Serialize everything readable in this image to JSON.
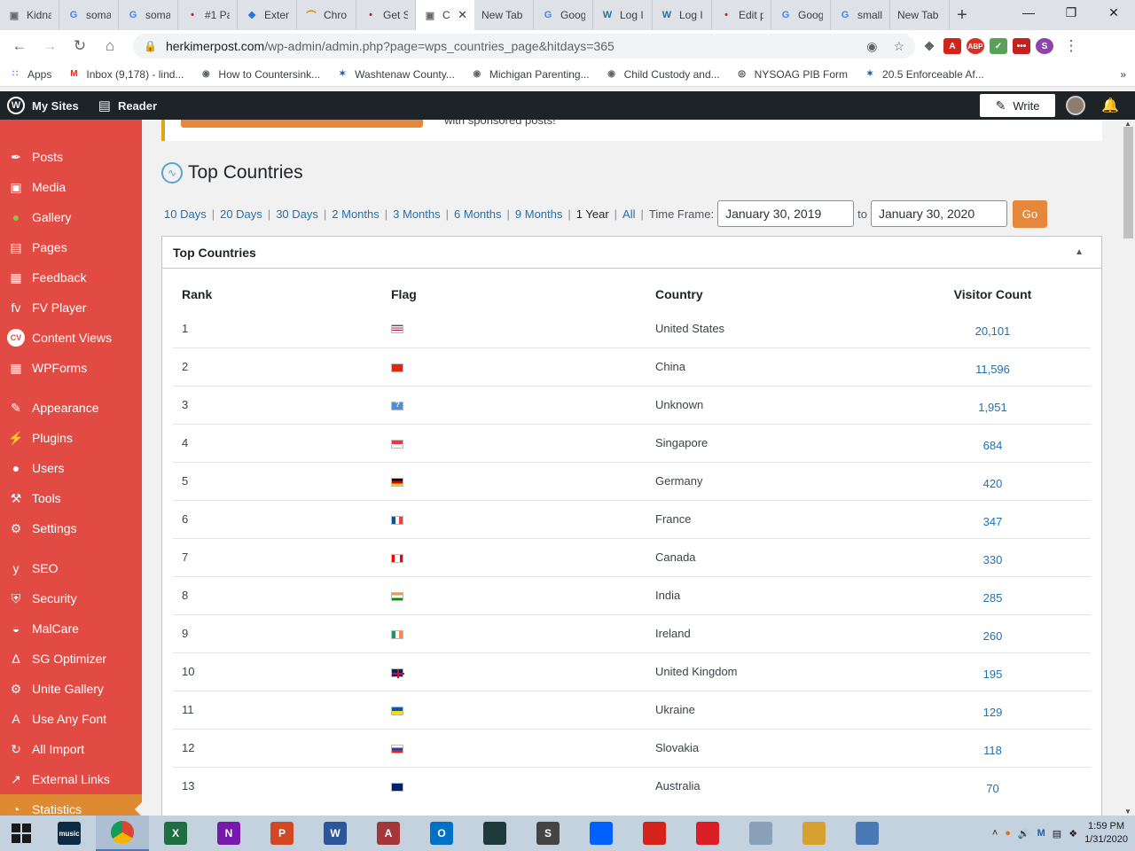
{
  "browser": {
    "tabs": [
      {
        "title": "Kidna",
        "icon": "site-icon",
        "color": "#6b6b6b"
      },
      {
        "title": "soma",
        "icon": "google-icon",
        "color": "#4285f4"
      },
      {
        "title": "soma",
        "icon": "google-icon",
        "color": "#4285f4"
      },
      {
        "title": "#1 Pa",
        "icon": "red-dots-icon",
        "color": "#c5221f"
      },
      {
        "title": "Exten",
        "icon": "puzzle-icon",
        "color": "#1a73e8"
      },
      {
        "title": "Chro",
        "icon": "rainbow-icon",
        "color": "#e37400"
      },
      {
        "title": "Get S",
        "icon": "red-dots-icon",
        "color": "#c5221f"
      },
      {
        "title": "C",
        "icon": "site-icon",
        "color": "#6b6b6b",
        "active": true
      },
      {
        "title": "New Tab",
        "icon": "",
        "color": ""
      },
      {
        "title": "Goog",
        "icon": "google-icon",
        "color": "#4285f4"
      },
      {
        "title": "Log I",
        "icon": "wordpress-icon",
        "color": "#21759b"
      },
      {
        "title": "Log I",
        "icon": "wordpress-icon",
        "color": "#21759b"
      },
      {
        "title": "Edit p",
        "icon": "red-dots-icon",
        "color": "#c5221f"
      },
      {
        "title": "Goog",
        "icon": "google-icon",
        "color": "#4285f4"
      },
      {
        "title": "small",
        "icon": "google-icon",
        "color": "#4285f4"
      },
      {
        "title": "New Tab",
        "icon": "",
        "color": ""
      }
    ],
    "new_tab_symbol": "+",
    "url_domain": "herkimerpost.com",
    "url_path": "/wp-admin/admin.php?page=wps_countries_page&hitdays=365",
    "bookmarks": [
      {
        "label": "Apps",
        "icon": "apps-grid-icon"
      },
      {
        "label": "Inbox (9,178) - lind...",
        "icon": "gmail-icon"
      },
      {
        "label": "How to Countersink...",
        "icon": "site-icon"
      },
      {
        "label": "Washtenaw County...",
        "icon": "seal-icon"
      },
      {
        "label": "Michigan Parenting...",
        "icon": "site-icon"
      },
      {
        "label": "Child Custody and...",
        "icon": "site-icon"
      },
      {
        "label": "NYSOAG PIB Form",
        "icon": "globe-icon"
      },
      {
        "label": "20.5 Enforceable Af...",
        "icon": "seal-icon"
      }
    ]
  },
  "adminbar": {
    "my_sites": "My Sites",
    "reader": "Reader",
    "write": "Write"
  },
  "sidebar": {
    "items": [
      {
        "label": "Posts",
        "icon": "pin-icon"
      },
      {
        "label": "Media",
        "icon": "media-icon"
      },
      {
        "label": "Gallery",
        "icon": "gallery-icon"
      },
      {
        "label": "Pages",
        "icon": "pages-icon"
      },
      {
        "label": "Feedback",
        "icon": "feedback-icon"
      },
      {
        "label": "FV Player",
        "icon": "fv-icon"
      },
      {
        "label": "Content Views",
        "icon": "cv-icon"
      },
      {
        "label": "WPForms",
        "icon": "forms-icon"
      },
      {
        "label": "Appearance",
        "icon": "brush-icon"
      },
      {
        "label": "Plugins",
        "icon": "plug-icon"
      },
      {
        "label": "Users",
        "icon": "user-icon"
      },
      {
        "label": "Tools",
        "icon": "wrench-icon"
      },
      {
        "label": "Settings",
        "icon": "settings-icon"
      },
      {
        "label": "SEO",
        "icon": "yoast-icon"
      },
      {
        "label": "Security",
        "icon": "shield-icon"
      },
      {
        "label": "MalCare",
        "icon": "malcare-icon"
      },
      {
        "label": "SG Optimizer",
        "icon": "sg-icon"
      },
      {
        "label": "Unite Gallery",
        "icon": "gear-icon"
      },
      {
        "label": "Use Any Font",
        "icon": "font-icon"
      },
      {
        "label": "All Import",
        "icon": "import-icon"
      },
      {
        "label": "External Links",
        "icon": "external-icon"
      },
      {
        "label": "Statistics",
        "icon": "stats-icon"
      }
    ],
    "colors": {
      "bg": "#e24b44",
      "current": "#dd8a32"
    }
  },
  "notice": {
    "text": "with sponsored posts!"
  },
  "page": {
    "title": "Top Countries",
    "ranges": [
      "10 Days",
      "20 Days",
      "30 Days",
      "2 Months",
      "3 Months",
      "6 Months",
      "9 Months",
      "1 Year",
      "All"
    ],
    "current_range": "1 Year",
    "time_frame_label": "Time Frame:",
    "from_date": "January 30, 2019",
    "to_label": "to",
    "to_date": "January 30, 2020",
    "go_label": "Go"
  },
  "table": {
    "box_title": "Top Countries",
    "headers": [
      "Rank",
      "Flag",
      "Country",
      "Visitor Count"
    ],
    "rows": [
      {
        "rank": "1",
        "country": "United States",
        "count": "20,101",
        "flag": "us"
      },
      {
        "rank": "2",
        "country": "China",
        "count": "11,596",
        "flag": "cn"
      },
      {
        "rank": "3",
        "country": "Unknown",
        "count": "1,951",
        "flag": "unknown"
      },
      {
        "rank": "4",
        "country": "Singapore",
        "count": "684",
        "flag": "sg"
      },
      {
        "rank": "5",
        "country": "Germany",
        "count": "420",
        "flag": "de"
      },
      {
        "rank": "6",
        "country": "France",
        "count": "347",
        "flag": "fr"
      },
      {
        "rank": "7",
        "country": "Canada",
        "count": "330",
        "flag": "ca"
      },
      {
        "rank": "8",
        "country": "India",
        "count": "285",
        "flag": "in"
      },
      {
        "rank": "9",
        "country": "Ireland",
        "count": "260",
        "flag": "ie"
      },
      {
        "rank": "10",
        "country": "United Kingdom",
        "count": "195",
        "flag": "gb"
      },
      {
        "rank": "11",
        "country": "Ukraine",
        "count": "129",
        "flag": "ua"
      },
      {
        "rank": "12",
        "country": "Slovakia",
        "count": "118",
        "flag": "sk"
      },
      {
        "rank": "13",
        "country": "Australia",
        "count": "70",
        "flag": "au"
      }
    ]
  },
  "taskbar": {
    "apps": [
      {
        "name": "amazon-music-icon",
        "label": "music",
        "color": "#0d2b45"
      },
      {
        "name": "chrome-icon",
        "label": "",
        "color": "#4285f4",
        "active": true
      },
      {
        "name": "excel-icon",
        "label": "X",
        "color": "#1d6f42"
      },
      {
        "name": "onenote-icon",
        "label": "N",
        "color": "#7719aa"
      },
      {
        "name": "powerpoint-icon",
        "label": "P",
        "color": "#d24726"
      },
      {
        "name": "word-icon",
        "label": "W",
        "color": "#2b579a"
      },
      {
        "name": "access-icon",
        "label": "A",
        "color": "#a4373a"
      },
      {
        "name": "outlook-icon",
        "label": "O",
        "color": "#0072c6"
      },
      {
        "name": "filmora-icon",
        "label": "",
        "color": "#1f3a3a"
      },
      {
        "name": "scrivener-icon",
        "label": "S",
        "color": "#444444"
      },
      {
        "name": "dropbox-icon",
        "label": "",
        "color": "#0061fe"
      },
      {
        "name": "acrobat-icon",
        "label": "",
        "color": "#d4231b"
      },
      {
        "name": "creative-cloud-icon",
        "label": "",
        "color": "#da1f26"
      },
      {
        "name": "monitor-icon",
        "label": "",
        "color": "#8aa0b8"
      },
      {
        "name": "paint-icon",
        "label": "",
        "color": "#d8a030"
      },
      {
        "name": "photos-icon",
        "label": "",
        "color": "#4a7ab5"
      }
    ],
    "time": "1:59 PM",
    "date": "1/31/2020"
  }
}
